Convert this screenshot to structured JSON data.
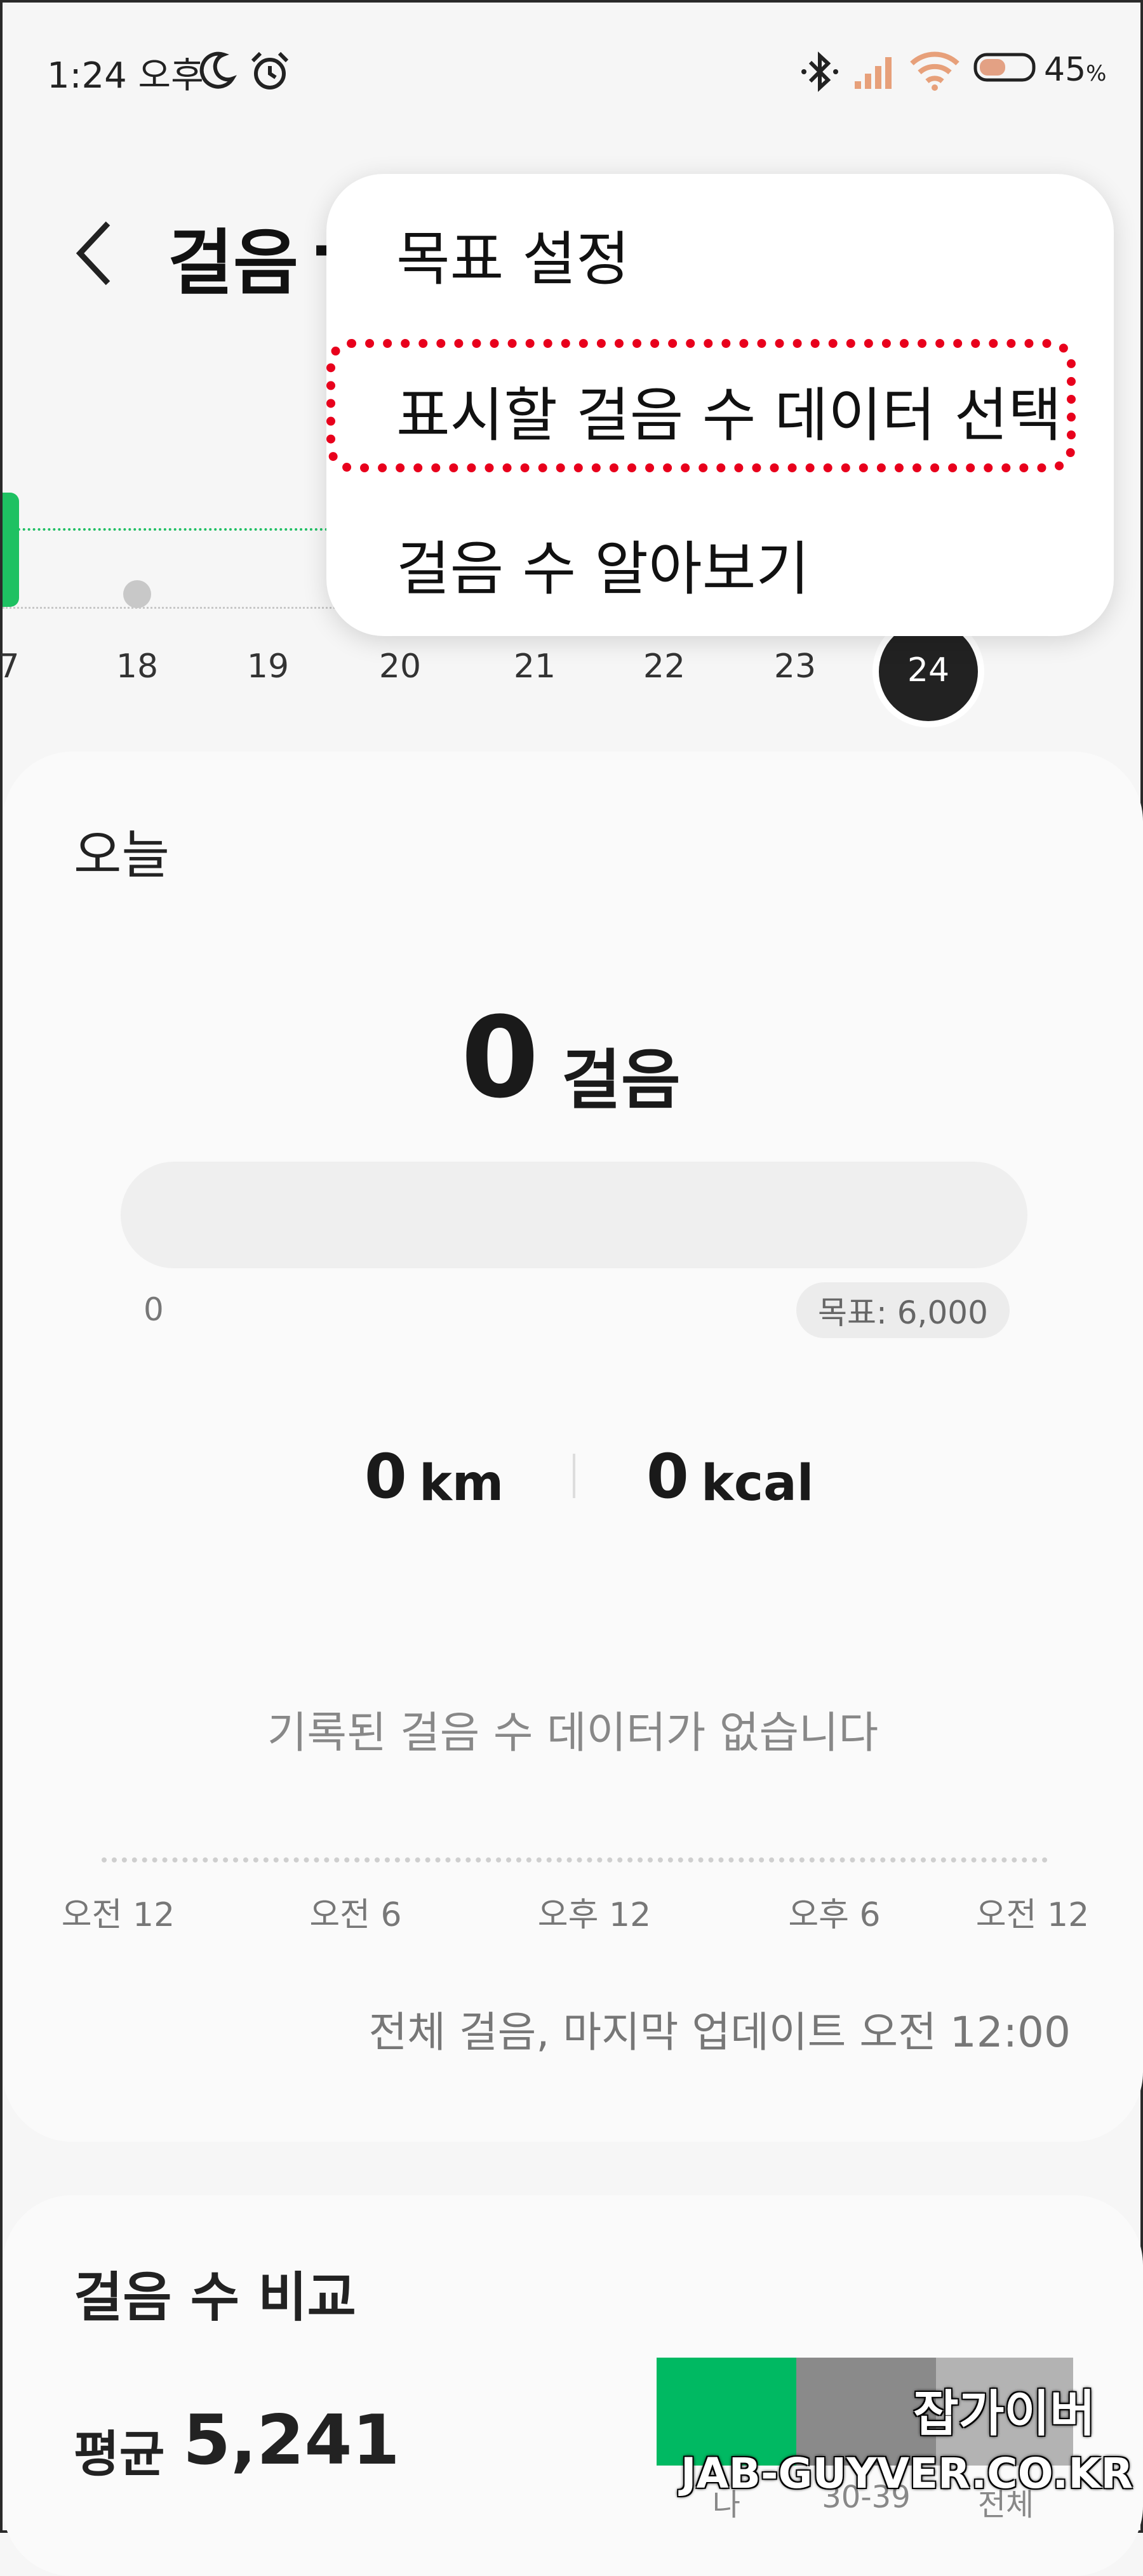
{
  "status_bar": {
    "time": "1:24 오후",
    "battery_percent": "45",
    "battery_symbol": "%",
    "icons": [
      "moon-icon",
      "alarm-icon",
      "bluetooth-icon",
      "signal-icon",
      "wifi-icon",
      "battery-icon"
    ]
  },
  "header": {
    "title": "걸음",
    "title_tail": "-"
  },
  "week": {
    "days": [
      "7",
      "18",
      "19",
      "20",
      "21",
      "22",
      "23",
      "24"
    ],
    "selected_day": "24"
  },
  "menu": {
    "items": [
      "목표 설정",
      "표시할 걸음 수 데이터 선택",
      "걸음 수 알아보기"
    ],
    "highlighted_index": 1,
    "highlight_color": "#e8001c"
  },
  "today": {
    "label": "오늘",
    "steps": "0",
    "steps_unit": "걸음",
    "progress_start": "0",
    "goal_label": "목표: 6,000",
    "goal_fraction": 0,
    "distance": "0",
    "distance_unit": "km",
    "calories": "0",
    "calories_unit": "kcal",
    "no_data_message": "기록된 걸음 수 데이터가 없습니다",
    "timeline_labels": [
      "오전 12",
      "오전 6",
      "오후 12",
      "오후 6",
      "오전 12"
    ],
    "last_update": "전체 걸음, 마지막 업데이트 오전 12:00"
  },
  "compare": {
    "title": "걸음 수 비교",
    "avg_label": "평균",
    "avg_value": "5,241",
    "groups": [
      {
        "label": "나",
        "color": "#00b962"
      },
      {
        "label": "30-39",
        "color": "#8a8a8a"
      },
      {
        "label": "전체",
        "color": "#b3b3b3"
      }
    ]
  },
  "watermark": {
    "line1": "잡가이버",
    "line2": "JAB-GUYVER.CO.KR"
  },
  "accent_color": "#1ec162"
}
